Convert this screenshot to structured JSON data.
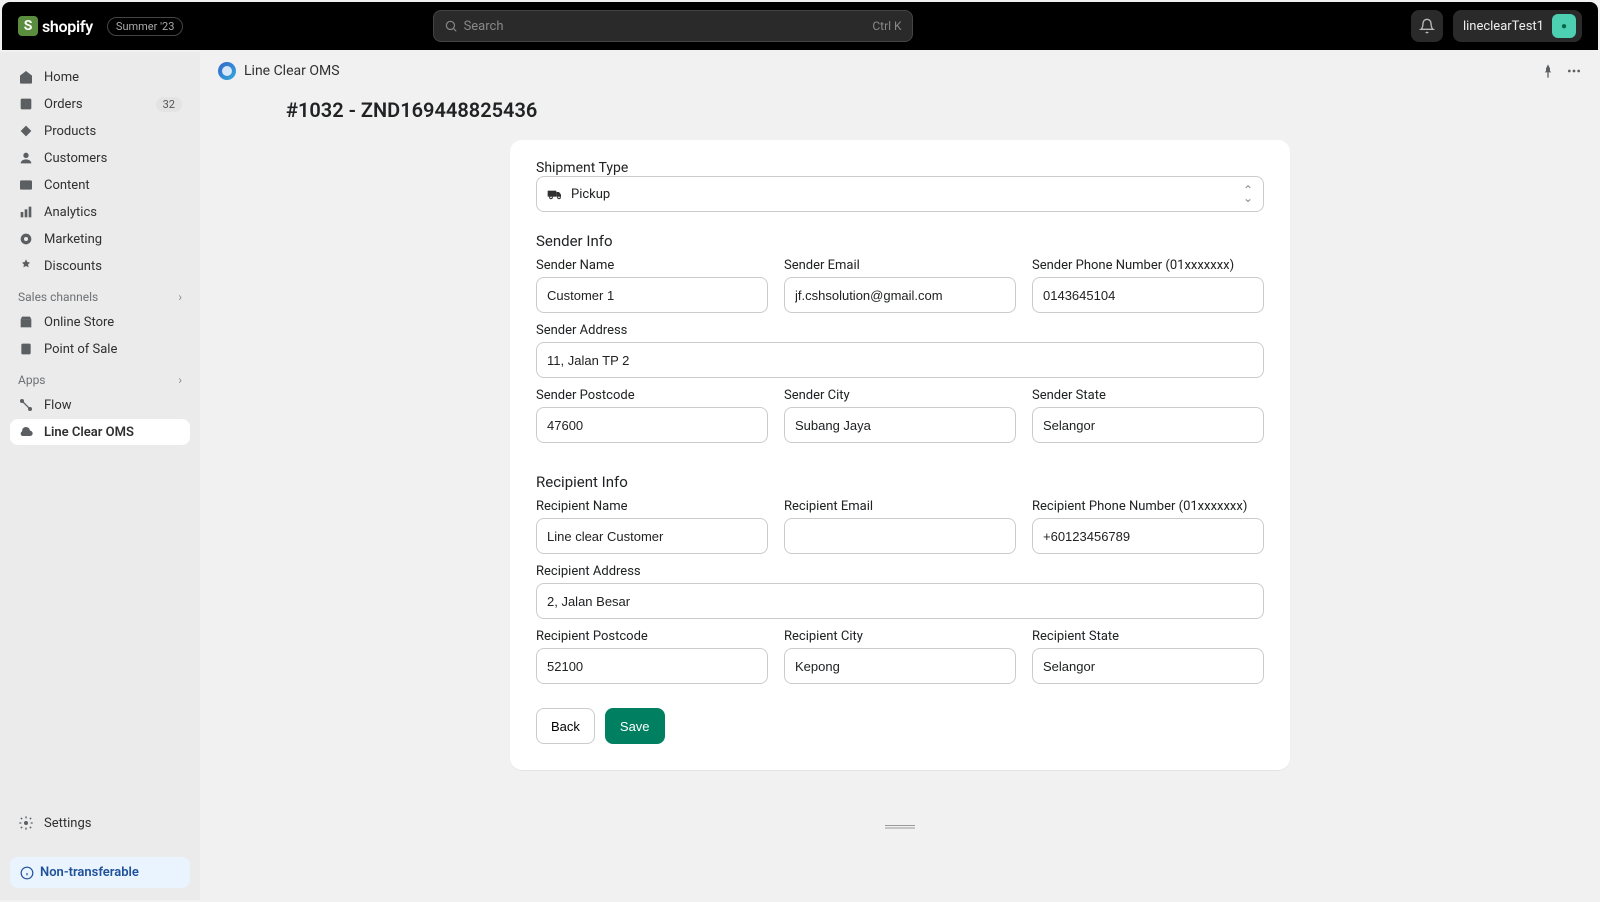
{
  "topbar": {
    "brand": "shopify",
    "edition_badge": "Summer '23",
    "search_placeholder": "Search",
    "search_kbd": "Ctrl K",
    "username": "lineclearTest1"
  },
  "sidebar": {
    "items": [
      {
        "label": "Home"
      },
      {
        "label": "Orders",
        "badge": "32"
      },
      {
        "label": "Products"
      },
      {
        "label": "Customers"
      },
      {
        "label": "Content"
      },
      {
        "label": "Analytics"
      },
      {
        "label": "Marketing"
      },
      {
        "label": "Discounts"
      }
    ],
    "sales_section": "Sales channels",
    "sales": [
      {
        "label": "Online Store"
      },
      {
        "label": "Point of Sale"
      }
    ],
    "apps_section": "Apps",
    "apps": [
      {
        "label": "Flow"
      },
      {
        "label": "Line Clear OMS"
      }
    ],
    "settings_label": "Settings",
    "nontransferable": "Non-transferable"
  },
  "app_header": {
    "title": "Line Clear OMS"
  },
  "page": {
    "title": "#1032 - ZND169448825436",
    "shipment_type_label": "Shipment Type",
    "shipment_type_value": "Pickup",
    "sender_info_title": "Sender Info",
    "sender": {
      "name_label": "Sender Name",
      "name": "Customer 1",
      "email_label": "Sender Email",
      "email": "jf.cshsolution@gmail.com",
      "phone_label": "Sender Phone Number (01xxxxxxx)",
      "phone": "0143645104",
      "address_label": "Sender Address",
      "address": "11, Jalan TP 2",
      "postcode_label": "Sender Postcode",
      "postcode": "47600",
      "city_label": "Sender City",
      "city": "Subang Jaya",
      "state_label": "Sender State",
      "state": "Selangor"
    },
    "recipient_info_title": "Recipient Info",
    "recipient": {
      "name_label": "Recipient Name",
      "name": "Line clear Customer",
      "email_label": "Recipient Email",
      "email": "",
      "phone_label": "Recipient Phone Number (01xxxxxxx)",
      "phone": "+60123456789",
      "address_label": "Recipient Address",
      "address": "2, Jalan Besar",
      "postcode_label": "Recipient Postcode",
      "postcode": "52100",
      "city_label": "Recipient City",
      "city": "Kepong",
      "state_label": "Recipient State",
      "state": "Selangor"
    },
    "back_label": "Back",
    "save_label": "Save"
  }
}
